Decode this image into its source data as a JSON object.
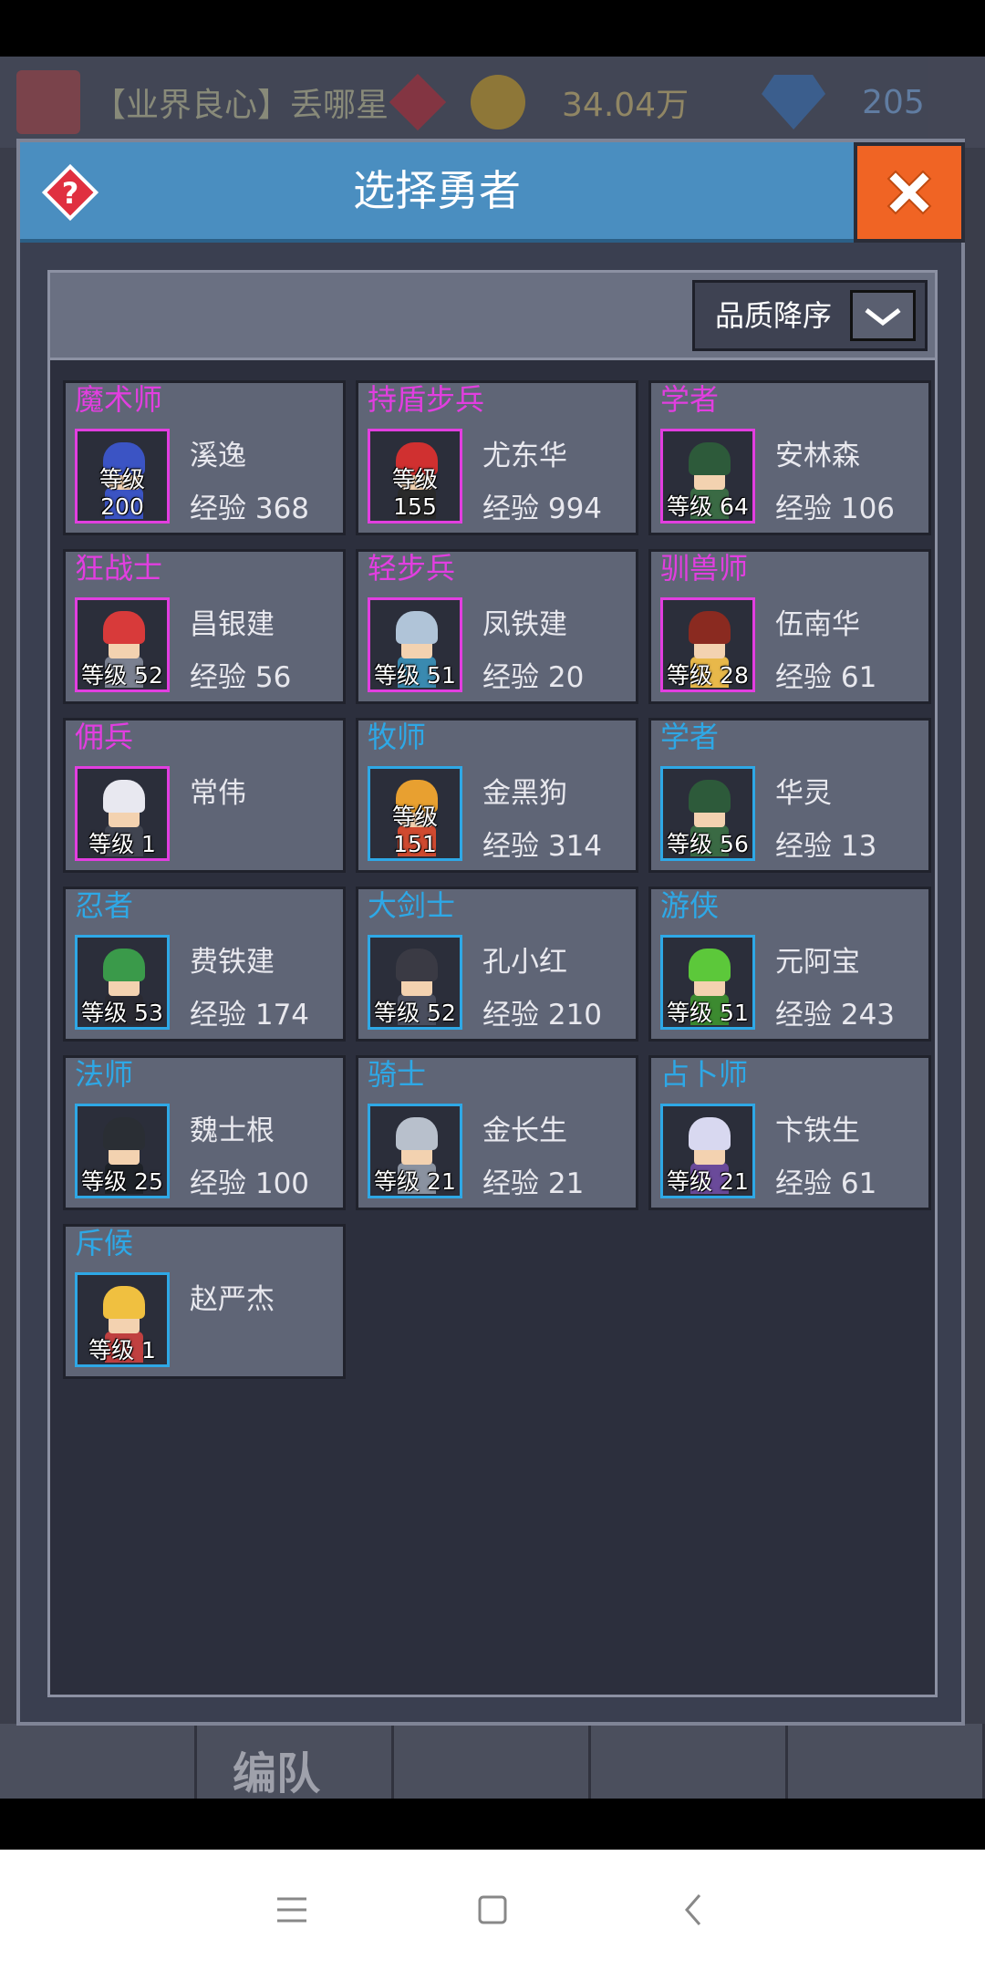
{
  "topbar": {
    "player_name": "【业界良心】丢哪星",
    "gold": "34.04万",
    "gems": "205"
  },
  "bottom_tabs": {
    "formation_label": "编队"
  },
  "dialog": {
    "title": "选择勇者",
    "sort_label": "品质降序",
    "colors": {
      "header": "#4a8ec0",
      "close": "#f06424",
      "purple": "#e23ee0",
      "blue": "#2ea8e6"
    },
    "heroes": [
      {
        "class": "魔术师",
        "name": "溪逸",
        "level": "等级 200",
        "exp": "经验 368",
        "quality": "purple",
        "hair": "#3b54c4",
        "bodyc": "#3b54c4"
      },
      {
        "class": "持盾步兵",
        "name": "尤东华",
        "level": "等级 155",
        "exp": "经验 994",
        "quality": "purple",
        "hair": "#d03030",
        "bodyc": "#2a2a2a"
      },
      {
        "class": "学者",
        "name": "安林森",
        "level": "等级 64",
        "exp": "经验 106",
        "quality": "purple",
        "hair": "#2d5a3a",
        "bodyc": "#3a6a44"
      },
      {
        "class": "狂战士",
        "name": "昌银建",
        "level": "等级 52",
        "exp": "经验 56",
        "quality": "purple",
        "hair": "#d83a3a",
        "bodyc": "#7a8090"
      },
      {
        "class": "轻步兵",
        "name": "凤铁建",
        "level": "等级 51",
        "exp": "经验 20",
        "quality": "purple",
        "hair": "#b0c4d8",
        "bodyc": "#3a8ab0"
      },
      {
        "class": "驯兽师",
        "name": "伍南华",
        "level": "等级 28",
        "exp": "经验 61",
        "quality": "purple",
        "hair": "#8a2a20",
        "bodyc": "#e8b84a"
      },
      {
        "class": "佣兵",
        "name": "常伟",
        "level": "等级 1",
        "exp": "",
        "quality": "purple",
        "hair": "#e8e8f0",
        "bodyc": "#404450"
      },
      {
        "class": "牧师",
        "name": "金黑狗",
        "level": "等级 151",
        "exp": "经验 314",
        "quality": "blue",
        "hair": "#e8a030",
        "bodyc": "#d04a30"
      },
      {
        "class": "学者",
        "name": "华灵",
        "level": "等级 56",
        "exp": "经验 13",
        "quality": "blue",
        "hair": "#2d5a3a",
        "bodyc": "#3a6a44"
      },
      {
        "class": "忍者",
        "name": "费铁建",
        "level": "等级 53",
        "exp": "经验 174",
        "quality": "blue",
        "hair": "#3a9a4a",
        "bodyc": "#2a2a32"
      },
      {
        "class": "大剑士",
        "name": "孔小红",
        "level": "等级 52",
        "exp": "经验 210",
        "quality": "blue",
        "hair": "#3a3a44",
        "bodyc": "#4a4e5e"
      },
      {
        "class": "游侠",
        "name": "元阿宝",
        "level": "等级 51",
        "exp": "经验 243",
        "quality": "blue",
        "hair": "#5cc83a",
        "bodyc": "#3c8a30"
      },
      {
        "class": "法师",
        "name": "魏士根",
        "level": "等级 25",
        "exp": "经验 100",
        "quality": "blue",
        "hair": "#2a2e34",
        "bodyc": "#1e2228"
      },
      {
        "class": "骑士",
        "name": "金长生",
        "level": "等级 21",
        "exp": "经验 21",
        "quality": "blue",
        "hair": "#b8c0cc",
        "bodyc": "#8a92a0"
      },
      {
        "class": "占卜师",
        "name": "卞铁生",
        "level": "等级 21",
        "exp": "经验 61",
        "quality": "blue",
        "hair": "#d8d8f0",
        "bodyc": "#6a4a9a"
      },
      {
        "class": "斥候",
        "name": "赵严杰",
        "level": "等级 1",
        "exp": "",
        "quality": "blue",
        "hair": "#f0c040",
        "bodyc": "#c04040"
      }
    ]
  }
}
